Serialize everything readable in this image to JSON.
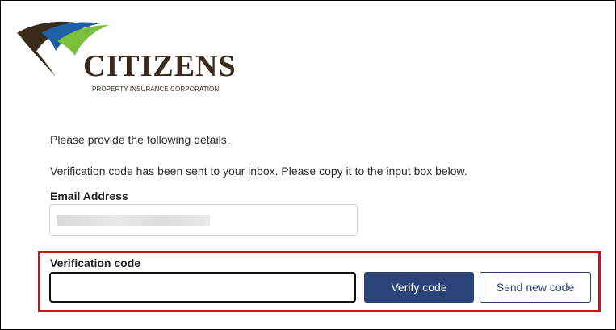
{
  "brand": {
    "name": "CITIZENS",
    "subtitle": "PROPERTY INSURANCE CORPORATION",
    "colors": {
      "blue": "#1e5fa8",
      "green": "#7cbf3a",
      "brown": "#3a2a1c"
    }
  },
  "form": {
    "intro": "Please provide the following details.",
    "notice": "Verification code has been sent to your inbox. Please copy it to the input box below.",
    "email_label": "Email Address",
    "email_value": "",
    "code_label": "Verification code",
    "code_value": "",
    "verify_button": "Verify code",
    "send_button": "Send new code"
  },
  "colors": {
    "highlight": "#d1121b",
    "primary": "#2a4379"
  },
  "icons": {
    "logo": "citizens-swoosh-logo"
  }
}
